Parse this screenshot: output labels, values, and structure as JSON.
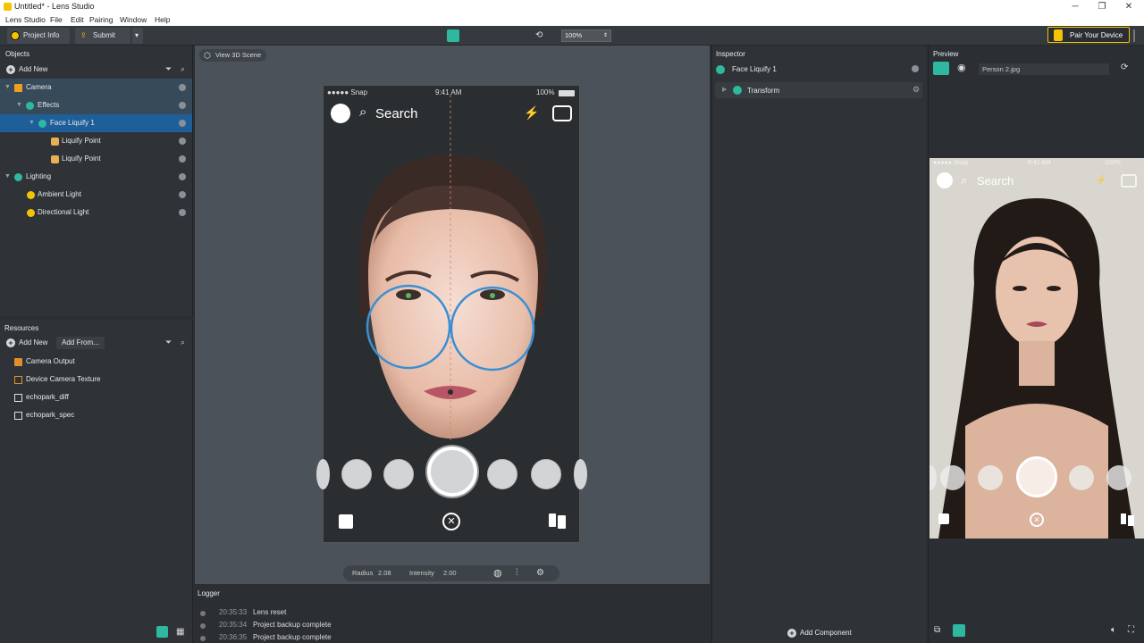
{
  "window": {
    "title": "Untitled* - Lens Studio",
    "minimize": "─",
    "maximize": "❐",
    "close": "✕"
  },
  "menu": [
    "Lens Studio",
    "File",
    "Edit",
    "Pairing",
    "Window",
    "Help"
  ],
  "toolbar": {
    "project_info": "Project Info",
    "submit_lens": "Submit Lens",
    "zoom": "100%",
    "pair_device": "Pair Your Device"
  },
  "objects": {
    "title": "Objects",
    "add_new": "Add New",
    "tree": [
      {
        "label": "Camera",
        "icon": "camera-icon"
      },
      {
        "label": "Effects",
        "icon": "effects-icon"
      },
      {
        "label": "Face Liquify 1",
        "icon": "face-liquify-icon"
      },
      {
        "label": "Liquify Point",
        "icon": "liquify-point-icon"
      },
      {
        "label": "Liquify Point",
        "icon": "liquify-point-icon"
      },
      {
        "label": "Lighting",
        "icon": "lighting-icon"
      },
      {
        "label": "Ambient Light",
        "icon": "light-bulb-icon"
      },
      {
        "label": "Directional Light",
        "icon": "light-bulb-icon"
      }
    ]
  },
  "resources": {
    "title": "Resources",
    "add_new": "Add New",
    "add_from": "Add From...",
    "items": [
      "Camera Output",
      "Device Camera Texture",
      "echopark_diff",
      "echopark_spec"
    ]
  },
  "viewport": {
    "view3d": "View 3D Scene",
    "status": {
      "carrier": "●●●●● Snap",
      "time": "9:41 AM",
      "battery": "100%"
    },
    "search": "Search",
    "radius_label": "Radius",
    "radius_value": "2.08",
    "intensity_label": "Intensity",
    "intensity_value": "2.00"
  },
  "logger": {
    "title": "Logger",
    "entries": [
      {
        "time": "20:35:33",
        "msg": "Lens reset"
      },
      {
        "time": "20:35:34",
        "msg": "Project backup complete"
      },
      {
        "time": "20:36:35",
        "msg": "Project backup complete"
      }
    ]
  },
  "inspector": {
    "title": "Inspector",
    "object": "Face Liquify 1",
    "transform": "Transform",
    "add_component": "Add Component"
  },
  "preview": {
    "title": "Preview",
    "image": "Person 2.jpg",
    "status": {
      "carrier": "●●●●● Snap",
      "time": "9:41 AM",
      "battery": "100%"
    },
    "search": "Search"
  },
  "colors": {
    "accent": "#1e5f99",
    "snap_yellow": "#f5c400",
    "liquify_ring": "#3a8fd4",
    "teal_icon": "#2fb8a0"
  }
}
